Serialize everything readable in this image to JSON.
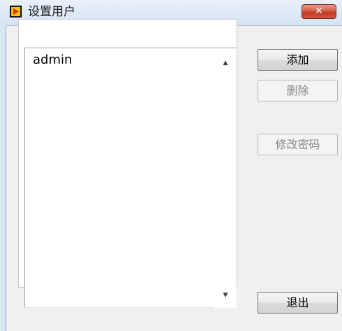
{
  "window": {
    "title": "设置用户",
    "close_label": "✕"
  },
  "user_list": {
    "items": [
      "admin"
    ],
    "scroll_up": "▲",
    "scroll_down": "▼"
  },
  "buttons": {
    "add": "添加",
    "delete": "删除",
    "change_password": "修改密码",
    "exit": "退出"
  },
  "colors": {
    "titlebar": "#dbe6f3",
    "close_button": "#c8432c",
    "client_bg": "#f0f0f0"
  },
  "icons": {
    "app": "labview-app-icon"
  }
}
